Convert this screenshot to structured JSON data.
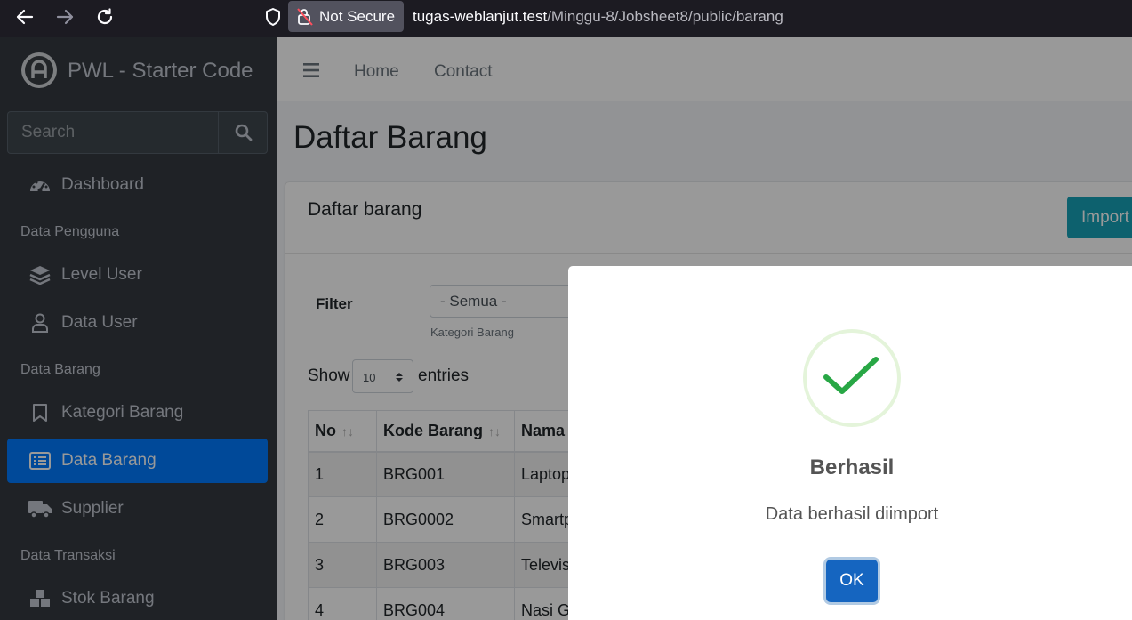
{
  "browser": {
    "security_label": "Not Secure",
    "url_host": "tugas-weblanjut.test",
    "url_path": "/Minggu-8/Jobsheet8/public/barang"
  },
  "sidebar": {
    "brand": "PWL - Starter Code",
    "search_placeholder": "Search",
    "items": [
      {
        "label": "Dashboard",
        "icon": "dashboard-icon"
      },
      {
        "header": "Data Pengguna"
      },
      {
        "label": "Level User",
        "icon": "layers-icon"
      },
      {
        "label": "Data User",
        "icon": "user-icon"
      },
      {
        "header": "Data Barang"
      },
      {
        "label": "Kategori Barang",
        "icon": "bookmark-icon"
      },
      {
        "label": "Data Barang",
        "icon": "list-icon",
        "active": true
      },
      {
        "label": "Supplier",
        "icon": "truck-icon"
      },
      {
        "header": "Data Transaksi"
      },
      {
        "label": "Stok Barang",
        "icon": "cubes-icon"
      }
    ]
  },
  "topnav": {
    "home": "Home",
    "contact": "Contact"
  },
  "page": {
    "title": "Daftar Barang",
    "card_title": "Daftar barang",
    "import_label": "Import",
    "filter_label": "Filter",
    "filter_value": "- Semua -",
    "filter_help": "Kategori Barang",
    "show_label": "Show",
    "entries_value": "10",
    "entries_label": "entries"
  },
  "table": {
    "headers": [
      "No",
      "Kode Barang",
      "Nama"
    ],
    "rows": [
      [
        "1",
        "BRG001",
        "Laptop"
      ],
      [
        "2",
        "BRG0002",
        "Smartphone"
      ],
      [
        "3",
        "BRG003",
        "Televisi"
      ],
      [
        "4",
        "BRG004",
        "Nasi Goreng"
      ]
    ]
  },
  "dialog": {
    "title": "Berhasil",
    "text": "Data berhasil diimport",
    "ok_label": "OK",
    "accent": "#28a745"
  }
}
